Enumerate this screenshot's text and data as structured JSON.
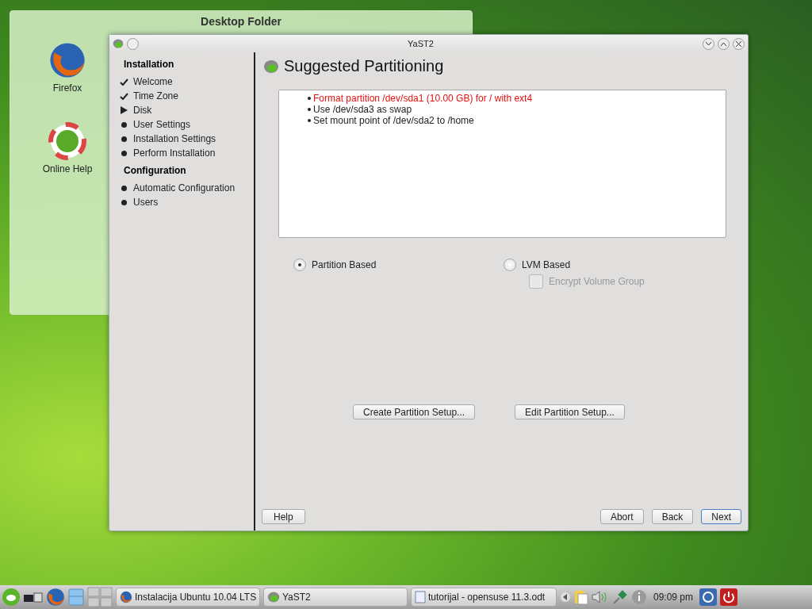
{
  "desktop_folder": {
    "title": "Desktop Folder",
    "icons": [
      {
        "label": "Firefox",
        "kind": "browser"
      },
      {
        "label": "Online Help",
        "kind": "help"
      }
    ]
  },
  "window": {
    "title": "YaST2"
  },
  "sidebar": {
    "sections": [
      {
        "title": "Installation",
        "items": [
          {
            "label": "Welcome",
            "kind": "done"
          },
          {
            "label": "Time Zone",
            "kind": "done"
          },
          {
            "label": "Disk",
            "kind": "current"
          },
          {
            "label": "User Settings",
            "kind": "pending"
          },
          {
            "label": "Installation Settings",
            "kind": "pending"
          },
          {
            "label": "Perform Installation",
            "kind": "pending"
          }
        ]
      },
      {
        "title": "Configuration",
        "items": [
          {
            "label": "Automatic Configuration",
            "kind": "pending"
          },
          {
            "label": "Users",
            "kind": "pending"
          }
        ]
      }
    ]
  },
  "page": {
    "title": "Suggested Partitioning",
    "summary": [
      {
        "text": "Format partition /dev/sda1 (10.00 GB) for / with ext4",
        "highlighted": true
      },
      {
        "text": "Use /dev/sda3 as swap",
        "highlighted": false
      },
      {
        "text": "Set mount point of /dev/sda2 to /home",
        "highlighted": false
      }
    ],
    "options": [
      {
        "label": "Partition Based",
        "selected": true
      },
      {
        "label": "LVM Based",
        "selected": false
      }
    ],
    "encrypt": {
      "label": "Encrypt Volume Group",
      "checked": false,
      "disabled": true
    },
    "setup_buttons": [
      "Create Partition Setup...",
      "Edit Partition Setup..."
    ],
    "footer": {
      "help": "Help",
      "buttons": [
        {
          "label": "Abort",
          "default": false
        },
        {
          "label": "Back",
          "default": false
        },
        {
          "label": "Next",
          "default": true
        }
      ]
    }
  },
  "taskbar": {
    "tasks": [
      {
        "label": "Instalacija Ubuntu 10.04 LTS",
        "kind": "browser"
      },
      {
        "label": "YaST2",
        "kind": "yast"
      },
      {
        "label": "tutorijal - opensuse 11.3.odt",
        "kind": "document"
      }
    ],
    "clock": "09:09 pm"
  }
}
